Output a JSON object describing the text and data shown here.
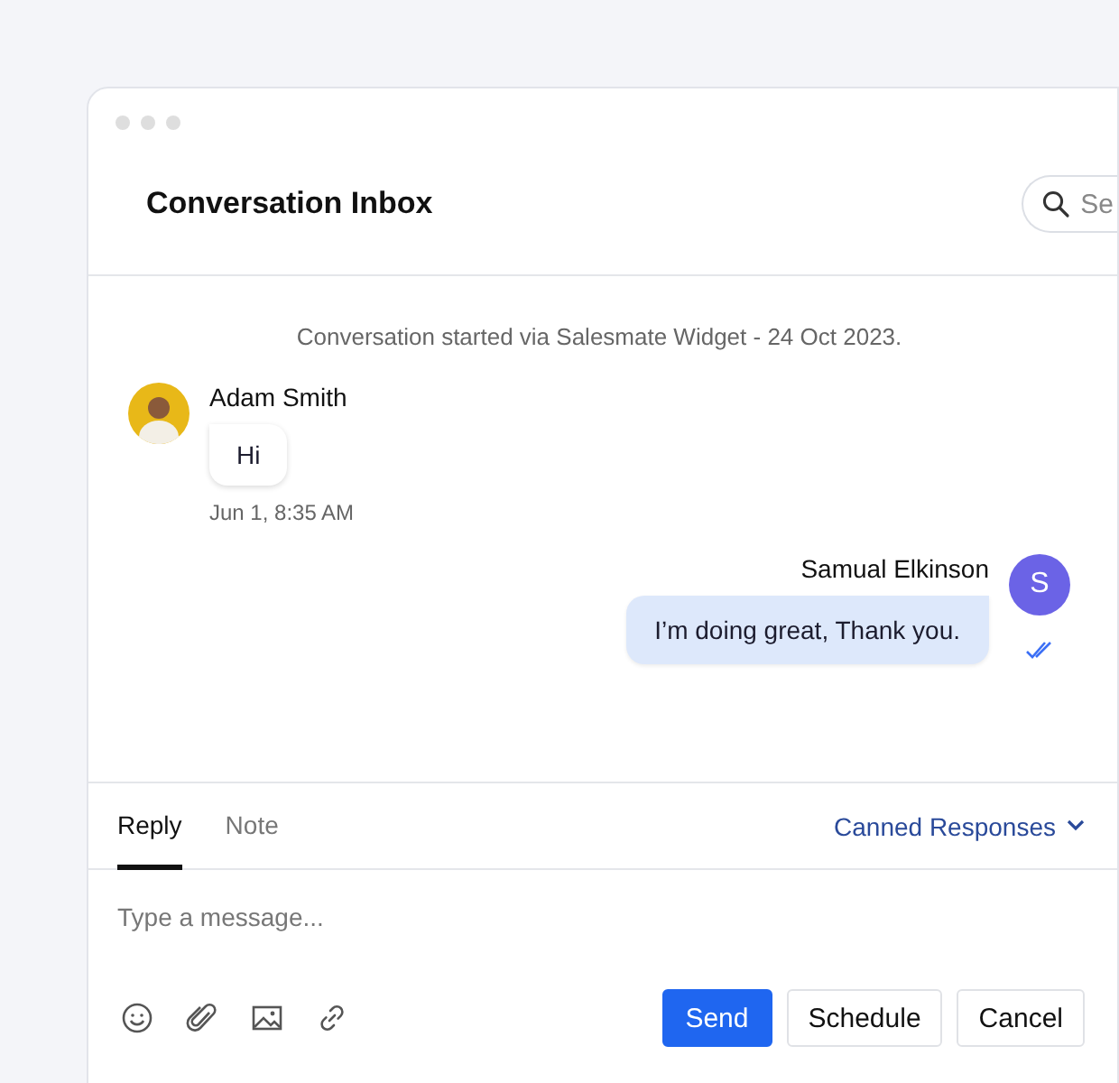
{
  "window": {
    "title": "Conversation Inbox"
  },
  "search": {
    "placeholder": "Se"
  },
  "system_note": "Conversation started via Salesmate Widget - 24 Oct 2023.",
  "messages": [
    {
      "kind": "incoming",
      "sender": "Adam Smith",
      "text": "Hi",
      "time": "Jun 1, 8:35 AM"
    },
    {
      "kind": "outgoing",
      "sender": "Samual Elkinson",
      "avatar_initial": "S",
      "text": "I’m doing great, Thank you.",
      "read": true
    }
  ],
  "composer": {
    "tabs": [
      {
        "label": "Reply",
        "selected": true
      },
      {
        "label": "Note",
        "selected": false
      }
    ],
    "canned_responses": "Canned Responses",
    "placeholder": "Type a message...",
    "buttons": [
      {
        "kind": "primary",
        "label": "Send"
      },
      {
        "kind": "secondary",
        "label": "Schedule"
      },
      {
        "kind": "secondary",
        "label": "Cancel"
      }
    ]
  }
}
